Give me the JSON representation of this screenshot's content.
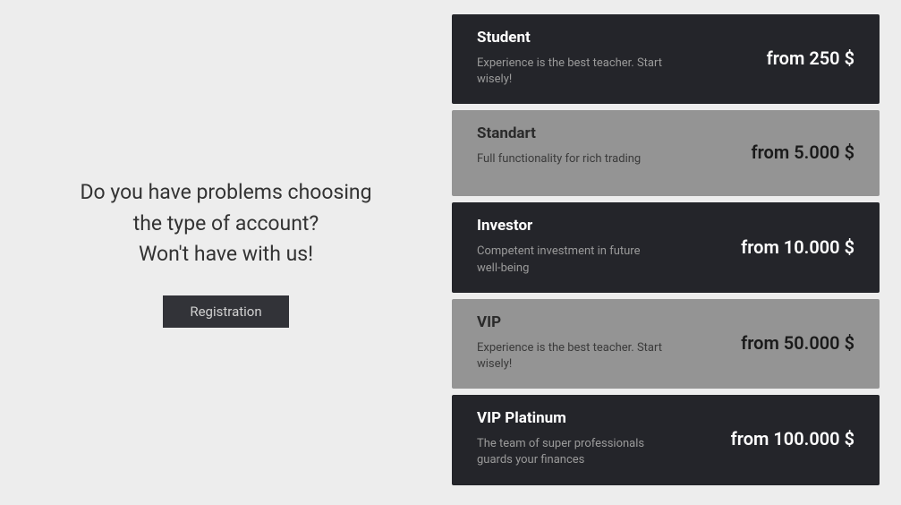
{
  "left": {
    "heading_line1": "Do you have problems choosing",
    "heading_line2": "the type of account?",
    "heading_line3": "Won't have with us!",
    "registration_button": "Registration"
  },
  "plans": [
    {
      "title": "Student",
      "description": "Experience is the best teacher. Start wisely!",
      "price": "from 250 $",
      "variant": "dark"
    },
    {
      "title": "Standart",
      "description": "Full functionality for rich trading",
      "price": "from 5.000 $",
      "variant": "light"
    },
    {
      "title": "Investor",
      "description": "Competent investment in future well-being",
      "price": "from 10.000 $",
      "variant": "dark"
    },
    {
      "title": "VIP",
      "description": "Experience is the best teacher. Start wisely!",
      "price": "from 50.000 $",
      "variant": "light"
    },
    {
      "title": "VIP Platinum",
      "description": "The team of super professionals guards your finances",
      "price": "from 100.000 $",
      "variant": "dark"
    }
  ]
}
